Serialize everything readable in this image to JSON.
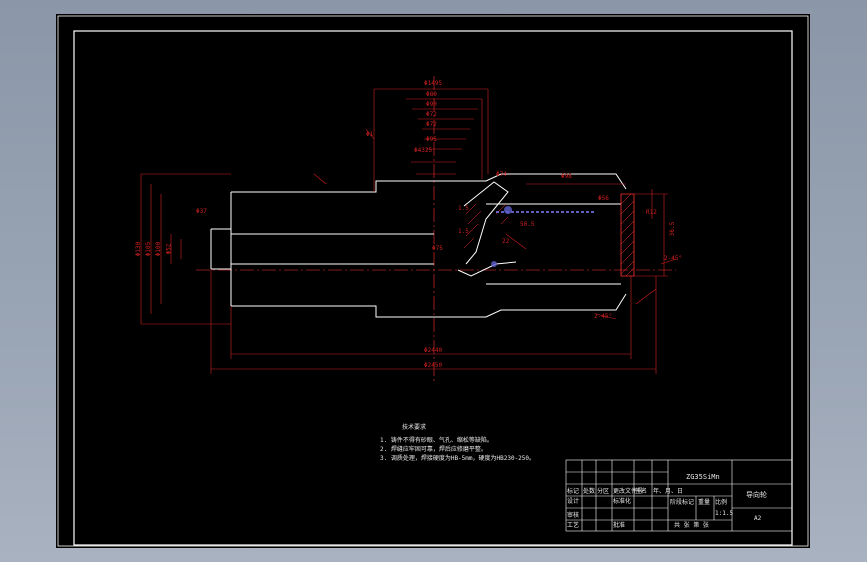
{
  "drawing": {
    "colors": {
      "frame": "#ffffff",
      "contour": "#ffffff",
      "dimension": "#ff2020",
      "center_line": "#ff3030",
      "hatch": "#ff3030",
      "weld": "#8080ff"
    },
    "dimensions_top": [
      "Φ1495",
      "Φ80",
      "Φ90",
      "Φ72",
      "Φ72",
      "Φ95",
      "Φ4325",
      "Φ74",
      "Φ98"
    ],
    "dimensions_left": [
      "Φ130",
      "Φ105",
      "Φ100",
      "Φ52",
      "Φ37"
    ],
    "dimensions_bottom": [
      "Φ2440",
      "Φ2450"
    ],
    "callouts": [
      "2-45°",
      "2-45°",
      "22",
      "1.5",
      "1.5",
      "Φ56",
      "Φ75",
      "36.5",
      "Φ1",
      "R12",
      "50.5"
    ]
  },
  "notes": {
    "title": "技术要求",
    "items": [
      "1. 铸件不得有砂眼、气孔、缩松等缺陷。",
      "2. 焊缝应牢固可靠，焊后应修磨平整。",
      "3. 调质处理，焊接硬度为HB-5mm，硬度为HB230-250。"
    ]
  },
  "title_block": {
    "material": "ZG35SiMn",
    "part_name": "导向轮",
    "header_cells": [
      "标记",
      "处数",
      "分区",
      "更改文件号",
      "签名",
      "年、月、日"
    ],
    "design": "设计",
    "standardize": "标准化",
    "stage_mark": "阶段标记",
    "weight": "重量",
    "scale": "比例",
    "scale_value": "1:1.5",
    "review": "审核",
    "process": "工艺",
    "approve": "批准",
    "sheet_info": "共  张  第  张",
    "sheet_size": "A2"
  }
}
